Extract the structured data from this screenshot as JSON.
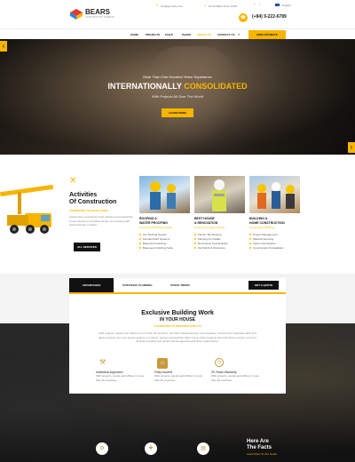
{
  "brand": {
    "name": "BEARS",
    "tagline": "CONSTRUCTION COMPANY"
  },
  "topbar": {
    "email": "info@yoursite.com",
    "address": "No 40 Baria Sreet 133/2",
    "phone": "(+84) 9-222-6789",
    "language": "English"
  },
  "nav": {
    "items": [
      "HOME",
      "PROJECTS",
      "FAQ'S",
      "PAGES",
      "ABOUT US",
      "CONTACT US"
    ],
    "cta": "FREE ESTIMATE"
  },
  "hero": {
    "kicker": "More Than One Hundred Years' Experience",
    "title_a": "INTERNATIONALLY",
    "title_b": "CONSOLIDATED",
    "subtitle": "With Projects All Over The World",
    "button": "LEARN MORE",
    "prev": "‹",
    "next": "›"
  },
  "activities": {
    "title_a": "Activities",
    "title_b": "Of Construction",
    "sub": "COMMITTED TO EXCELLENCE",
    "body": "Architecture consults the best designs and emphasize a commitment of complete design and working with great attention to detail.",
    "button": "ALL SERVICES"
  },
  "services": [
    {
      "title_a": "ROOFING &",
      "title_b": "WATER PROOFING",
      "sub": "Commercial Building Works",
      "items": [
        "Our Roofing System",
        "Flooded Roof Systems",
        "Basement Finishing",
        "Basement Finishing Suite"
      ]
    },
    {
      "title_a": "BEST HOUSE",
      "title_b": "& RENOVATION",
      "sub": "House Renovation Works",
      "items": [
        "Interior Tile Flooring",
        "Flooring Kit Installs",
        "Renovation Typical Roles",
        "Civil Work & Structures"
      ]
    },
    {
      "title_a": "BUILDING &",
      "title_b": "HOME CONSTRUCTION",
      "sub": "Construction Building",
      "items": [
        "Project Management",
        "Material Sourcing",
        "Space Optimization",
        "Construction & Installation"
      ]
    }
  ],
  "tabs": {
    "items": [
      "ADVANTAGES",
      "STRATEGIC PLANNING",
      "STOCK TREND"
    ],
    "cta": "GET A QUOTE"
  },
  "work": {
    "title_a": "Exclusive Building Work",
    "title_b": "IN YOUR HOUSE",
    "sub": "GUARANTEE OF WORKING WITH US",
    "body": "With projects, people and offices in more than 40 countries, the full professional team and expertise. Construction integrates skills and latest process, the most secure goal for our clients, product successfully within some of the toughest jobs and have a proven record of working smoothly with governmental agencies and other organizations.",
    "features": [
      {
        "icon": "hammer-icon",
        "title": "Individual Approach",
        "text": "With projects, people and offices in more than 40 countries."
      },
      {
        "icon": "house-icon",
        "title": "Fully Insured",
        "text": "With projects, people and offices in more than 40 countries."
      },
      {
        "icon": "clock-icon",
        "title": "20 Years Warranty",
        "text": "With projects, people and offices in more than 40 countries."
      }
    ]
  },
  "facts": {
    "title_a": "Here Are",
    "title_b": "The Facts",
    "sub": "Learn More To Our Goals"
  },
  "colors": {
    "accent": "#f7b500",
    "dark": "#111111"
  }
}
